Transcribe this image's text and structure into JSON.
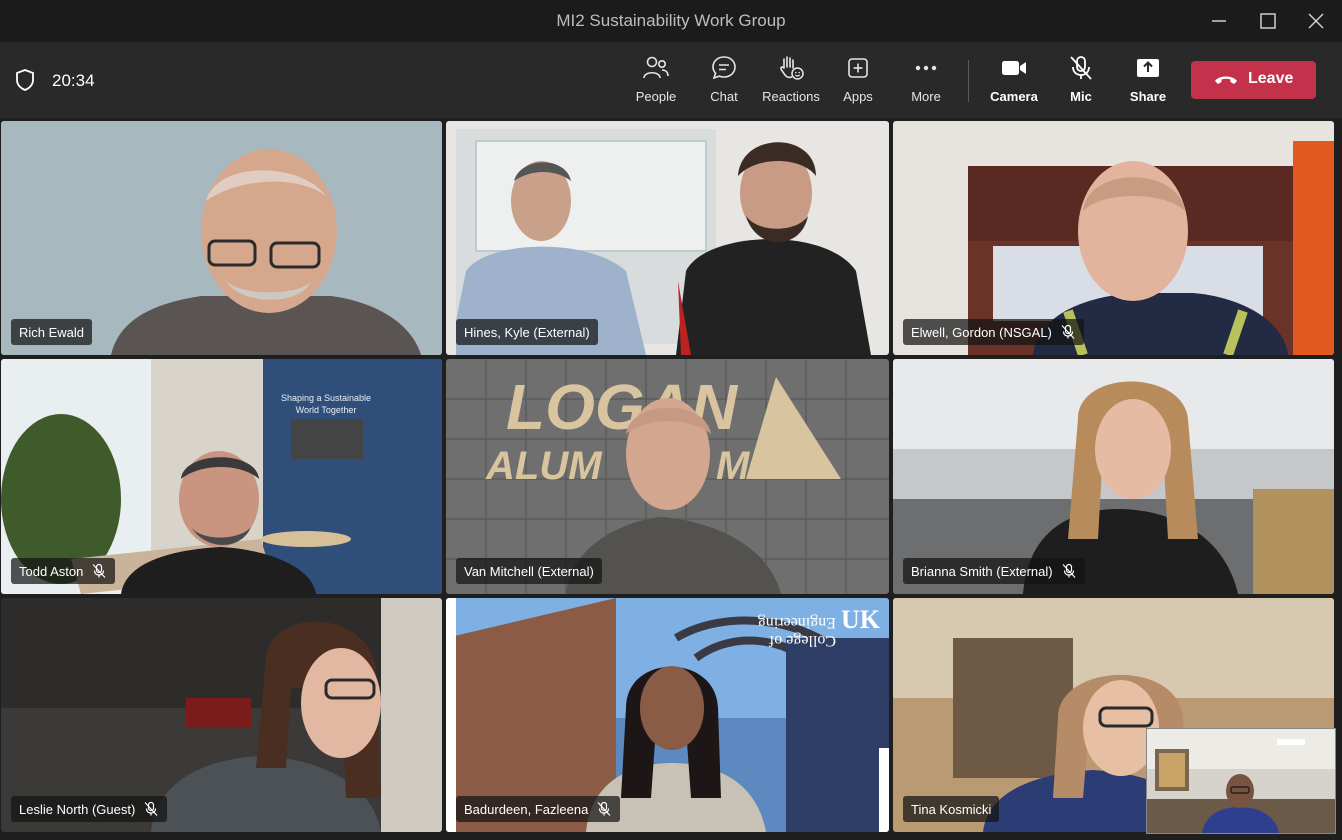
{
  "window": {
    "title": "MI2 Sustainability Work Group"
  },
  "meeting": {
    "elapsed": "20:34"
  },
  "toolbar": {
    "people": "People",
    "chat": "Chat",
    "reactions": "Reactions",
    "apps": "Apps",
    "more": "More",
    "camera": "Camera",
    "mic": "Mic",
    "share": "Share",
    "leave": "Leave"
  },
  "colors": {
    "leave": "#c4314b",
    "active_speaker": "#7f85f5",
    "toolbar": "#292929",
    "titlebar": "#1b1b1b"
  },
  "participants": [
    {
      "name": "Rich Ewald",
      "muted": false,
      "active": false
    },
    {
      "name": "Hines, Kyle (External)",
      "muted": false,
      "active": true
    },
    {
      "name": "Elwell, Gordon (NSGAL)",
      "muted": true,
      "active": false
    },
    {
      "name": "Todd Aston",
      "muted": true,
      "active": false
    },
    {
      "name": "Van Mitchell (External)",
      "muted": false,
      "active": false
    },
    {
      "name": "Brianna Smith (External)",
      "muted": true,
      "active": false
    },
    {
      "name": "Leslie North (Guest)",
      "muted": true,
      "active": false
    },
    {
      "name": "Badurdeen, Fazleena",
      "muted": true,
      "active": false
    },
    {
      "name": "Tina Kosmicki",
      "muted": false,
      "active": false
    }
  ],
  "backgrounds": {
    "logan": {
      "line1": "LOGAN",
      "line2": "ALUM",
      "line3": "M"
    },
    "aston_wall": {
      "line1": "Shaping a Sustainable",
      "line2": "World Together"
    },
    "uk": {
      "line1": "College of",
      "line2": "Engineering",
      "mark": "UK"
    }
  }
}
